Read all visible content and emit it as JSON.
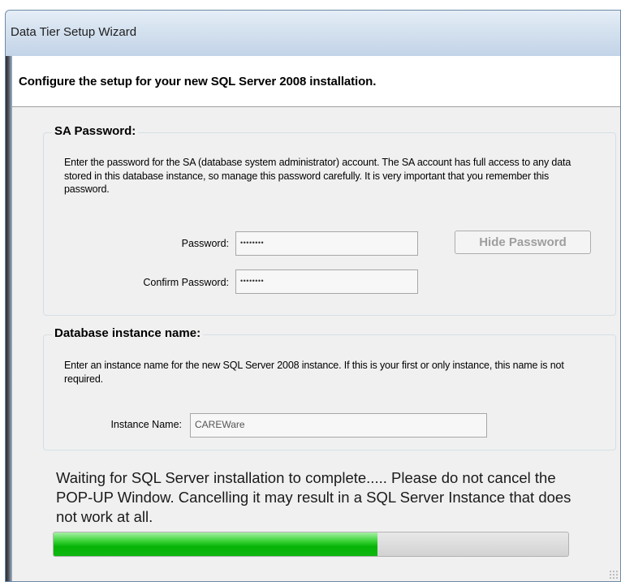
{
  "window": {
    "title": "Data Tier Setup Wizard"
  },
  "header": {
    "text": "Configure the setup for your new SQL Server 2008 installation."
  },
  "sa_password": {
    "title": "SA Password:",
    "description": "Enter the password for the SA (database system administrator) account. The SA account has full access to any data stored in this database instance, so manage this password carefully. It is very important that you remember this password.",
    "password_label": "Password:",
    "password_value": "••••••••",
    "confirm_label": "Confirm Password:",
    "confirm_value": "••••••••",
    "hide_button": "Hide Password"
  },
  "instance": {
    "title": "Database instance name:",
    "description": "Enter an instance name for the new SQL Server 2008 instance. If this is your first or only instance, this name is not required.",
    "name_label": "Instance Name:",
    "name_value": "CAREWare"
  },
  "status": {
    "message": "Waiting for SQL Server installation to complete..... Please do not cancel the POP-UP Window. Cancelling it may result in a SQL Server Instance that does not work at all.",
    "progress_percent": 63
  },
  "colors": {
    "progress_green": "#06b406",
    "header_bg": "#ffffff",
    "dialog_bg": "#f0f0f0"
  }
}
